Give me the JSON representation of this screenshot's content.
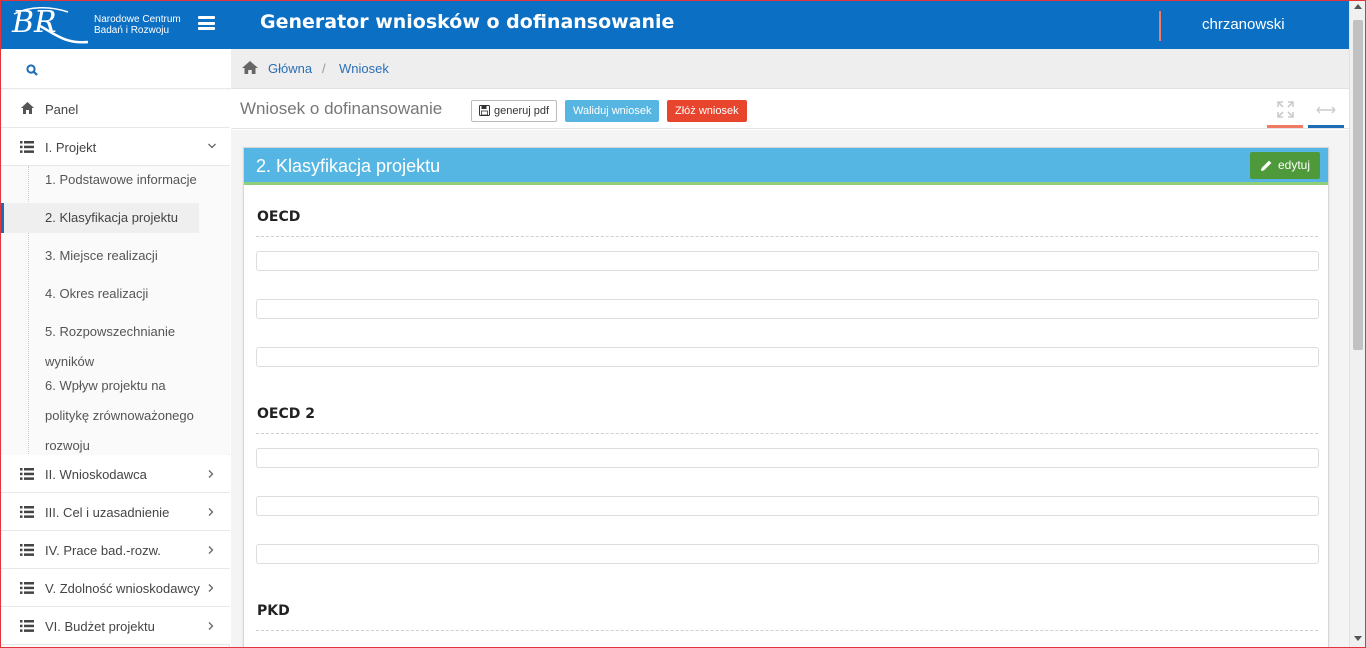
{
  "header": {
    "logo_line1": "Narodowe Centrum",
    "logo_line2": "Badań i Rozwoju",
    "app_title": "Generator wniosków o dofinansowanie",
    "username": "chrzanowski",
    "accent_color": "#0b6fc4"
  },
  "sidebar": {
    "search_icon": "search-icon",
    "items": [
      {
        "label": "Panel",
        "icon": "home-icon"
      },
      {
        "label": "I. Projekt",
        "icon": "list-icon",
        "expanded": true
      },
      {
        "label": "II. Wnioskodawca",
        "icon": "list-icon"
      },
      {
        "label": "III. Cel i uzasadnienie",
        "icon": "list-icon"
      },
      {
        "label": "IV. Prace bad.-rozw.",
        "icon": "list-icon"
      },
      {
        "label": "V. Zdolność wnioskodawcy",
        "icon": "list-icon"
      },
      {
        "label": "VI. Budżet projektu",
        "icon": "list-icon"
      }
    ],
    "project_subitems": [
      "1. Podstawowe informacje",
      "2. Klasyfikacja projektu",
      "3. Miejsce realizacji",
      "4. Okres realizacji",
      "5. Rozpowszechnianie",
      "wyników",
      "6. Wpływ projektu na",
      "politykę zrównoważonego",
      "rozwoju"
    ]
  },
  "breadcrumb": {
    "home": "Główna",
    "separator": "/",
    "current": "Wniosek"
  },
  "page": {
    "title": "Wniosek o dofinansowanie",
    "btn_pdf": "generuj pdf",
    "btn_validate": "Waliduj wniosek",
    "btn_submit": "Złóż wniosek"
  },
  "panel": {
    "title": "2. Klasyfikacja projektu",
    "edit_label": "edytuj",
    "sections": [
      {
        "label": "OECD"
      },
      {
        "label": "OECD 2"
      },
      {
        "label": "PKD"
      }
    ]
  },
  "colors": {
    "panel_header": "#56b6e3",
    "validate": "#57b5e1",
    "submit": "#e8452e",
    "edit": "#4e9a3a"
  }
}
